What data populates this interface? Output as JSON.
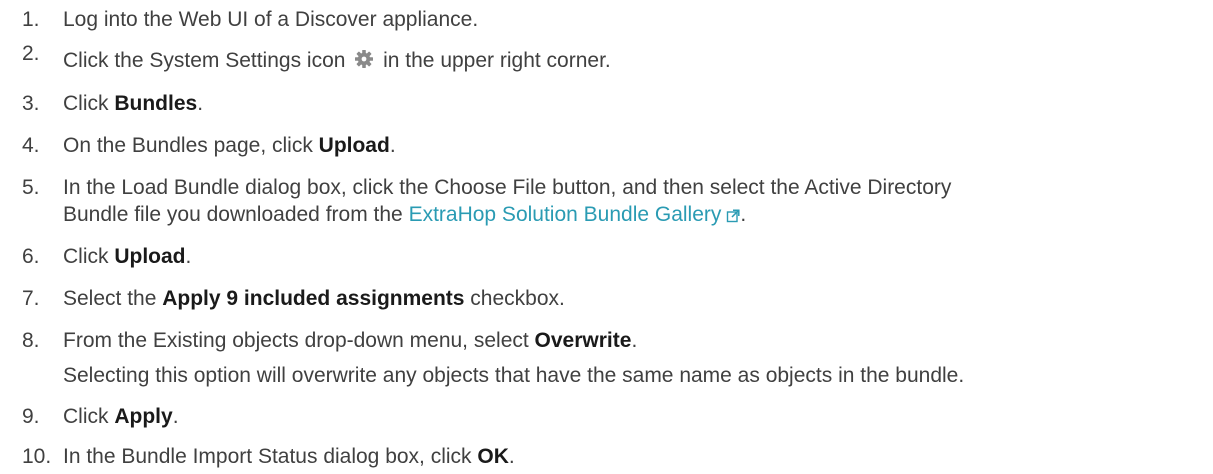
{
  "steps": [
    {
      "number": "1.",
      "text": "Log into the Web UI of a Discover appliance."
    },
    {
      "number": "2.",
      "before": "Click the System Settings icon",
      "after": "in the upper right corner.",
      "icon": "gear-icon"
    },
    {
      "number": "3.",
      "before": "Click ",
      "bold": "Bundles",
      "after": "."
    },
    {
      "number": "4.",
      "before": "On the Bundles page, click ",
      "bold": "Upload",
      "after": "."
    },
    {
      "number": "5.",
      "line1": "In the Load Bundle dialog box, click the Choose File button, and then select the Active Directory",
      "line2_before": "Bundle file you downloaded from the ",
      "link": "ExtraHop Solution Bundle Gallery",
      "line2_after": ".",
      "link_icon": "external-link-icon"
    },
    {
      "number": "6.",
      "before": "Click ",
      "bold": "Upload",
      "after": "."
    },
    {
      "number": "7.",
      "before": "Select the ",
      "bold": "Apply 9 included assignments",
      "after": " checkbox."
    },
    {
      "number": "8.",
      "before": "From the Existing objects drop-down menu, select ",
      "bold": "Overwrite",
      "after": ".",
      "note": "Selecting this option will overwrite any objects that have the same name as objects in the bundle."
    },
    {
      "number": "9.",
      "before": "Click ",
      "bold": "Apply",
      "after": "."
    },
    {
      "number": "10.",
      "before": "In the Bundle Import Status dialog box, click ",
      "bold": "OK",
      "after": "."
    }
  ],
  "colors": {
    "text": "#404040",
    "link": "#2a9bb3",
    "icon": "#8a8a8a"
  }
}
